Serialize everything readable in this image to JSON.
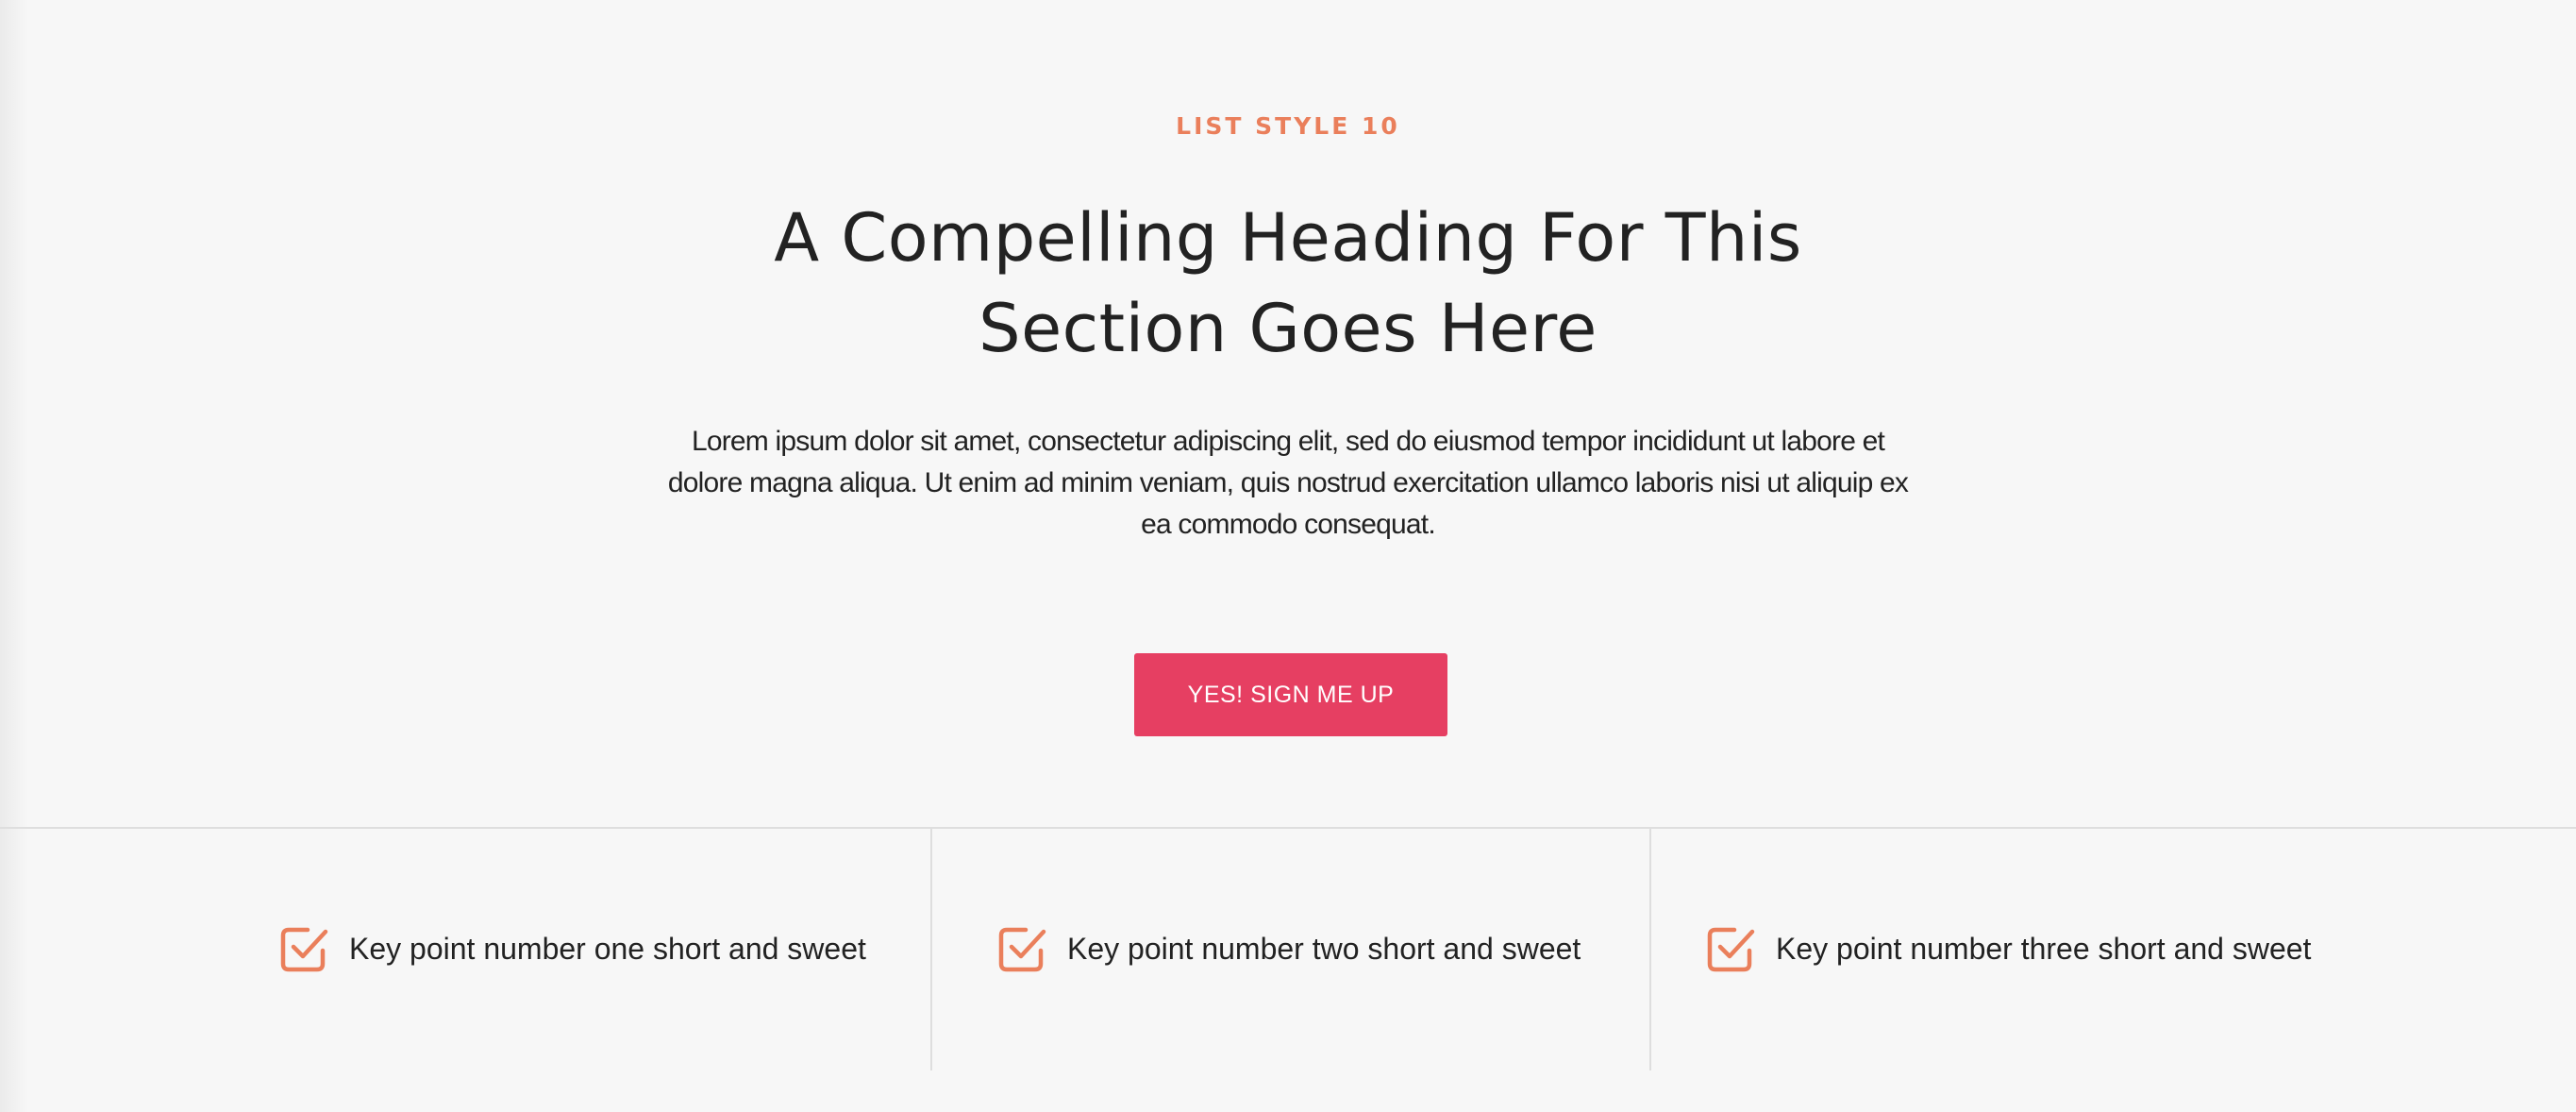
{
  "hero": {
    "eyebrow": "LIST STYLE 10",
    "heading": "A Compelling Heading For This Section Goes Here",
    "body": "Lorem ipsum dolor sit amet, consectetur adipiscing elit, sed do eiusmod tempor incididunt ut labore et dolore magna aliqua. Ut enim ad minim veniam, quis nostrud exercitation ullamco laboris nisi ut aliquip ex ea commodo consequat.",
    "cta_label": "YES! SIGN ME UP"
  },
  "key_points": [
    {
      "label": "Key point number one short and sweet",
      "icon": "checkbox-checked-icon"
    },
    {
      "label": "Key point number two short and sweet",
      "icon": "checkbox-checked-icon"
    },
    {
      "label": "Key point number three short and sweet",
      "icon": "checkbox-checked-icon"
    }
  ],
  "colors": {
    "accent": "#ea7f5b",
    "cta_background": "#e63f62",
    "background": "#f7f7f7",
    "text": "#222222",
    "divider": "#dedede"
  }
}
